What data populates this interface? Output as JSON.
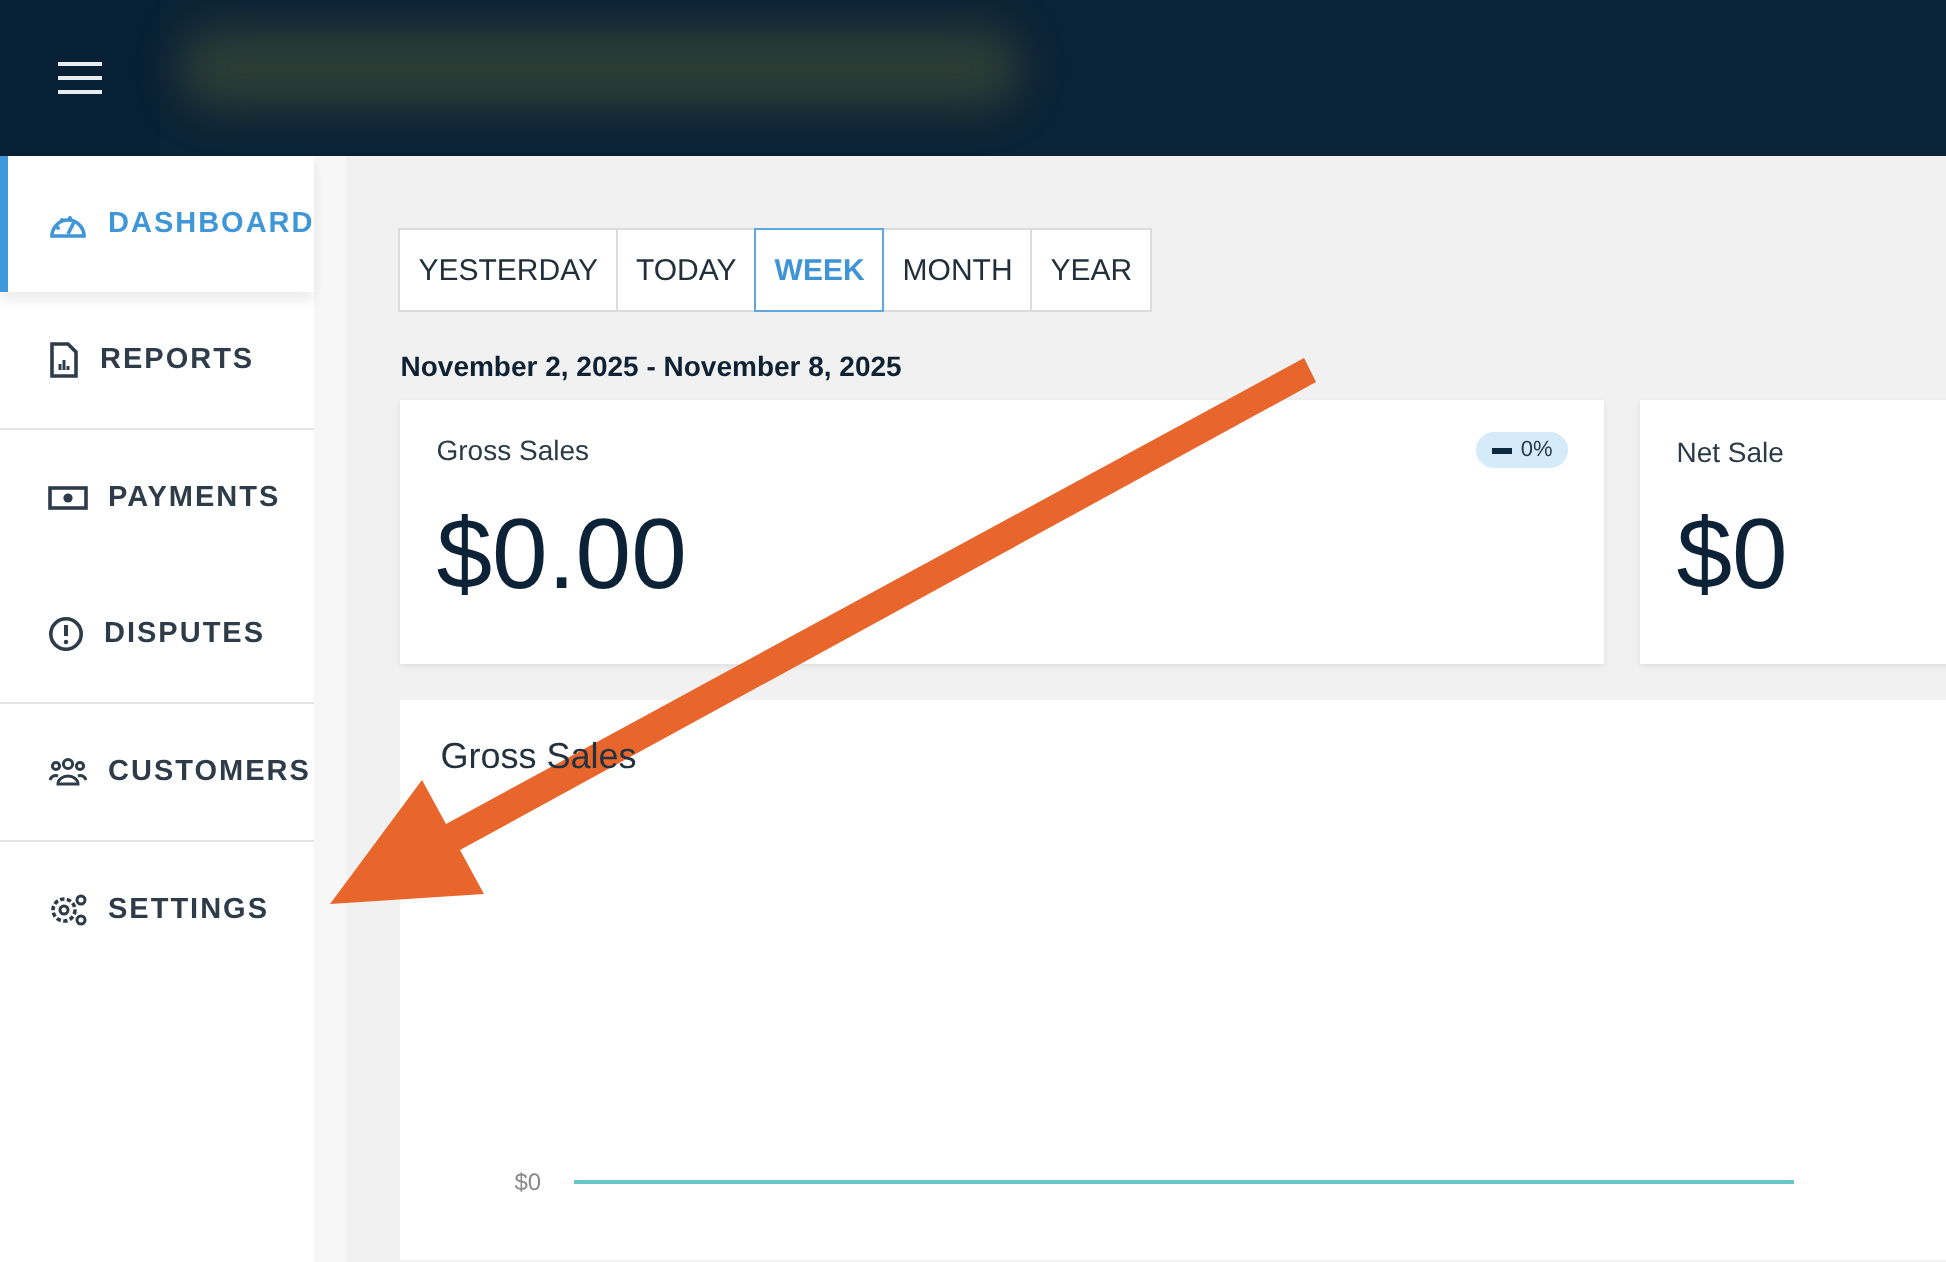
{
  "sidebar": {
    "sections": [
      {
        "items": [
          {
            "label": "DASHBOARD",
            "selected": true
          },
          {
            "label": "REPORTS",
            "selected": false
          }
        ]
      },
      {
        "items": [
          {
            "label": "PAYMENTS",
            "selected": false
          },
          {
            "label": "DISPUTES",
            "selected": false
          }
        ]
      },
      {
        "items": [
          {
            "label": "CUSTOMERS",
            "selected": false
          }
        ]
      },
      {
        "items": [
          {
            "label": "SETTINGS",
            "selected": false
          }
        ]
      }
    ]
  },
  "period_tabs": [
    {
      "label": "YESTERDAY",
      "selected": false
    },
    {
      "label": "TODAY",
      "selected": false
    },
    {
      "label": "WEEK",
      "selected": true
    },
    {
      "label": "MONTH",
      "selected": false
    },
    {
      "label": "YEAR",
      "selected": false
    }
  ],
  "date_range": "November 2, 2025 - November 8, 2025",
  "cards": [
    {
      "title": "Gross Sales",
      "value": "$0.00",
      "badge": "0%"
    },
    {
      "title": "Net Sale",
      "value": "$0"
    }
  ],
  "chart": {
    "title": "Gross Sales",
    "y_label": "$0"
  }
}
